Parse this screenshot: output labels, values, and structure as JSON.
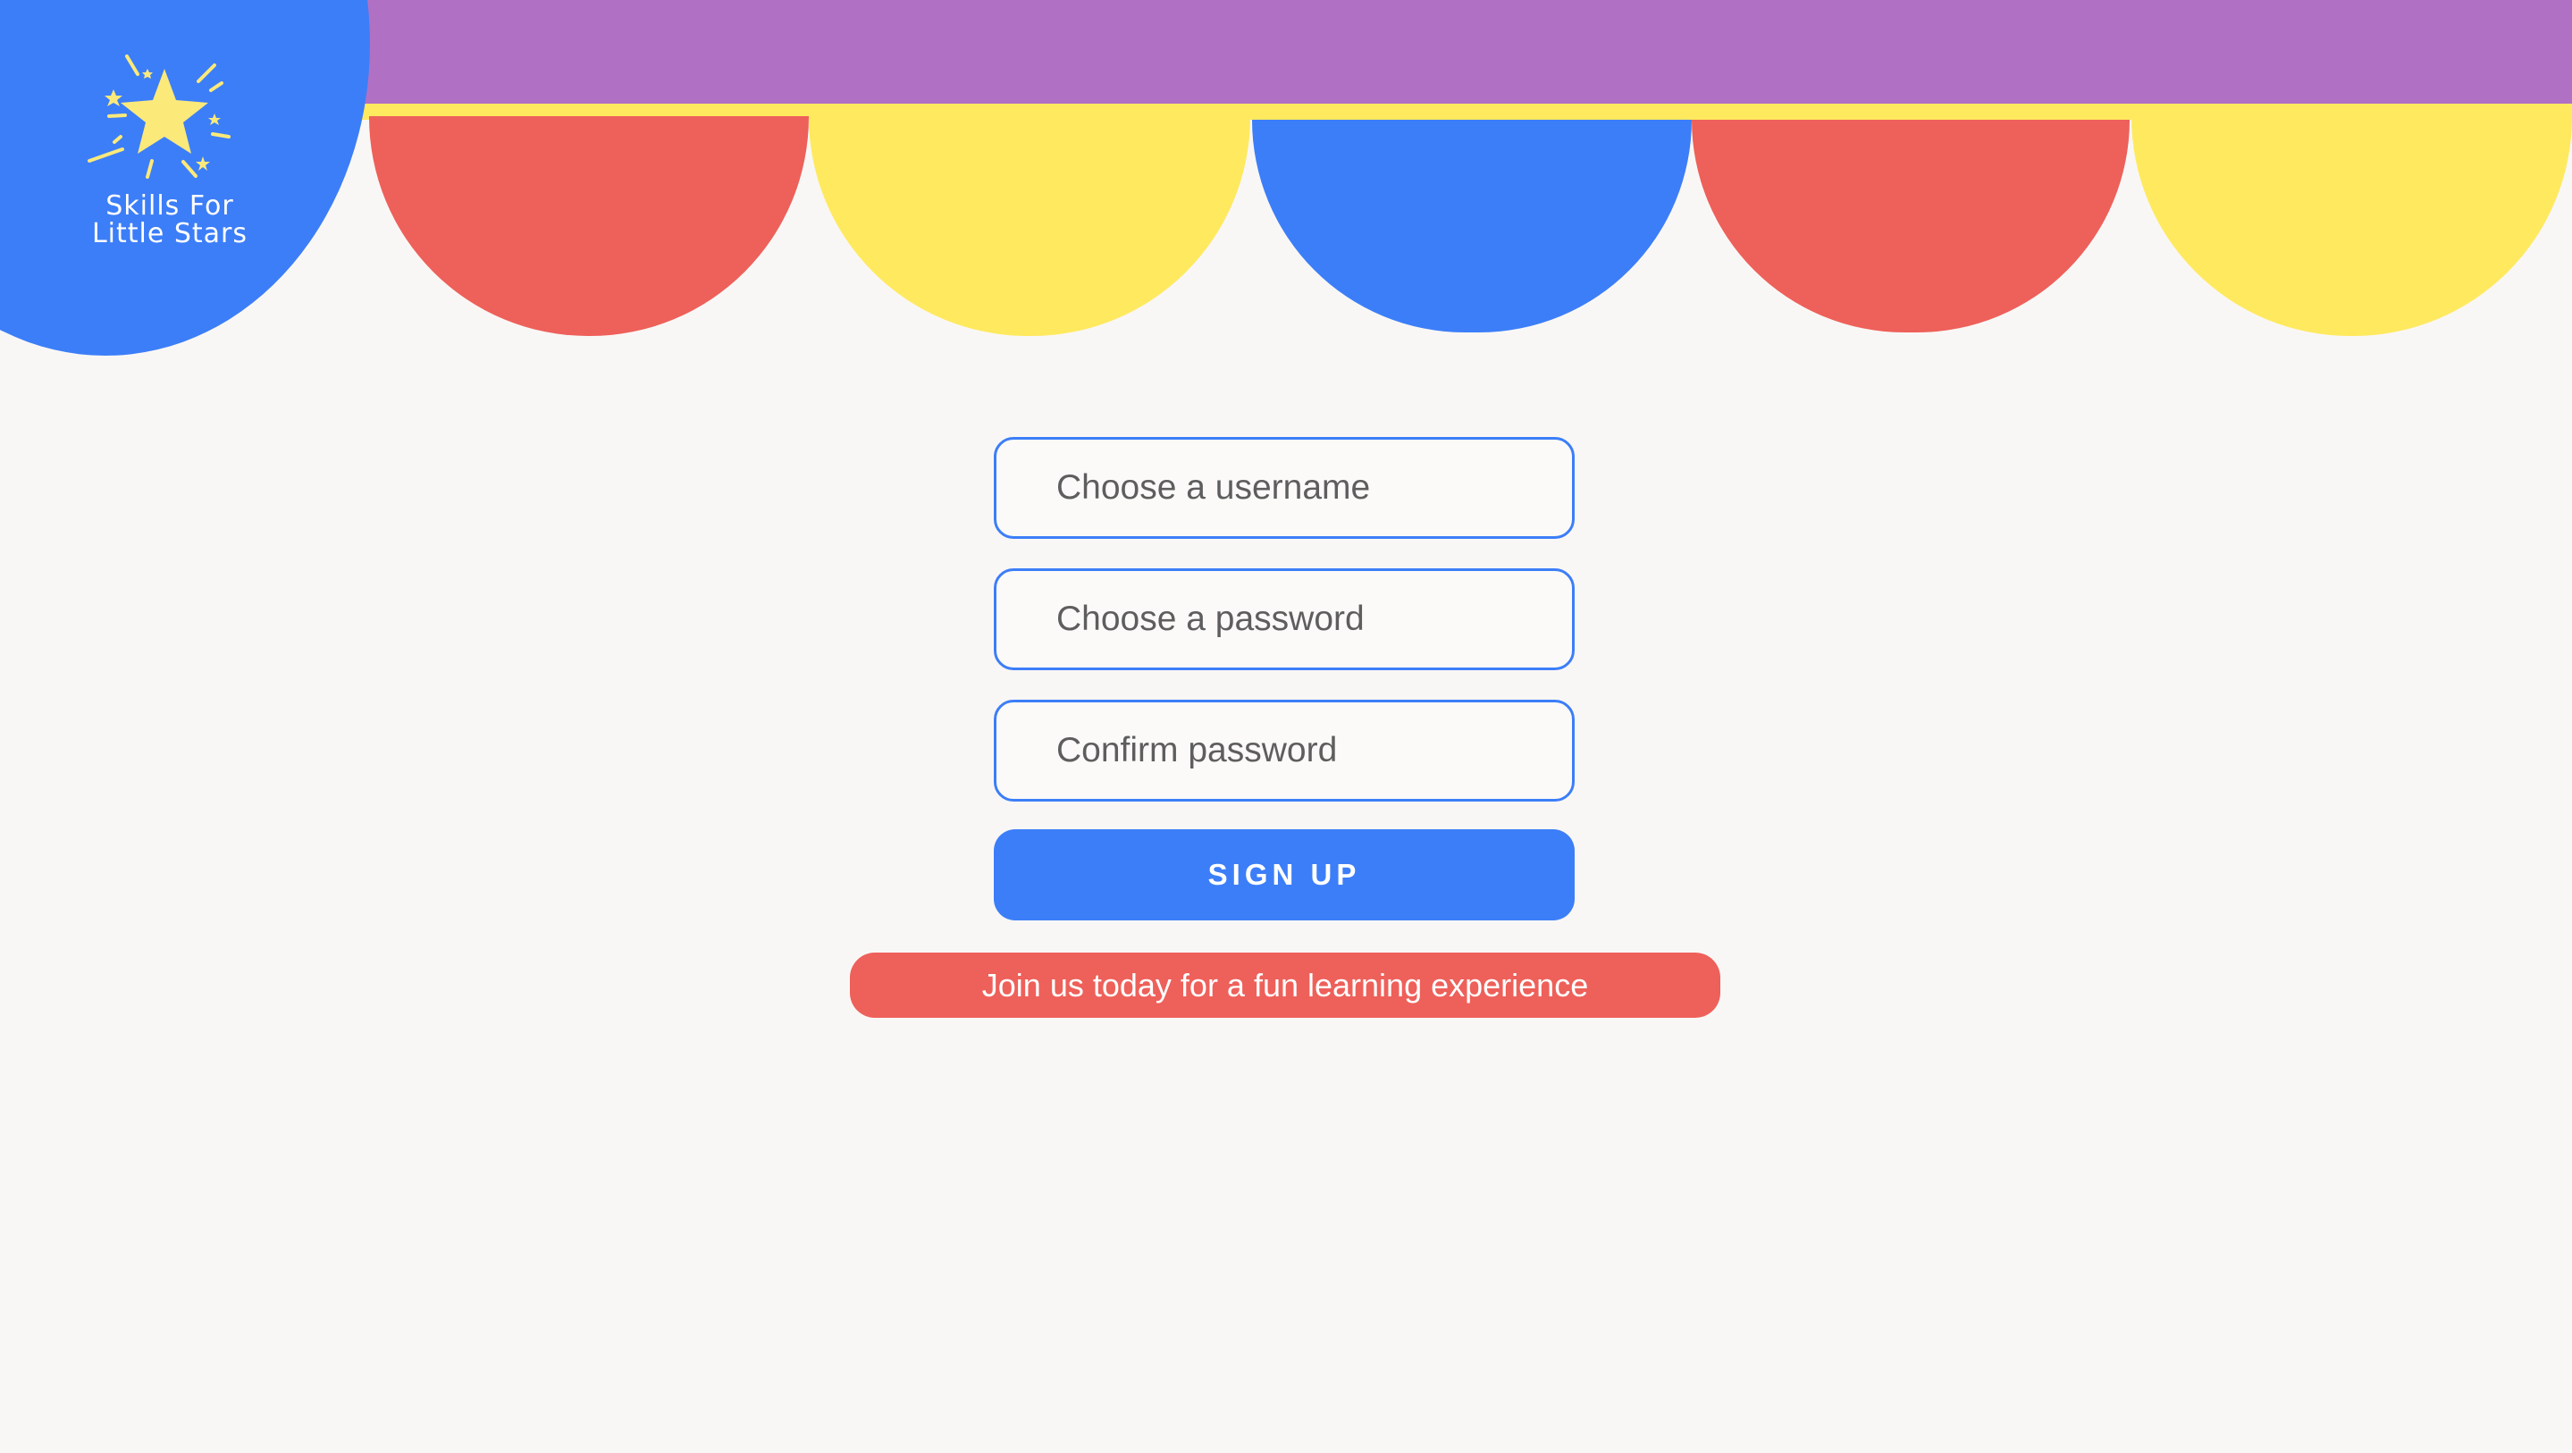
{
  "brand": {
    "logo_text_line1": "Skills For",
    "logo_text_line2": "Little Stars",
    "logo_icon": "star-burst-icon"
  },
  "signup_form": {
    "username_placeholder": "Choose a username",
    "password_placeholder": "Choose a password",
    "confirm_placeholder": "Confirm password",
    "submit_label": "SIGN UP"
  },
  "tagline": "Join us today for a fun learning experience",
  "colors": {
    "background": "#f9f7f5",
    "purple": "#b071c5",
    "yellow": "#ffe95f",
    "red": "#ee605a",
    "blue": "#3c7ef8"
  }
}
